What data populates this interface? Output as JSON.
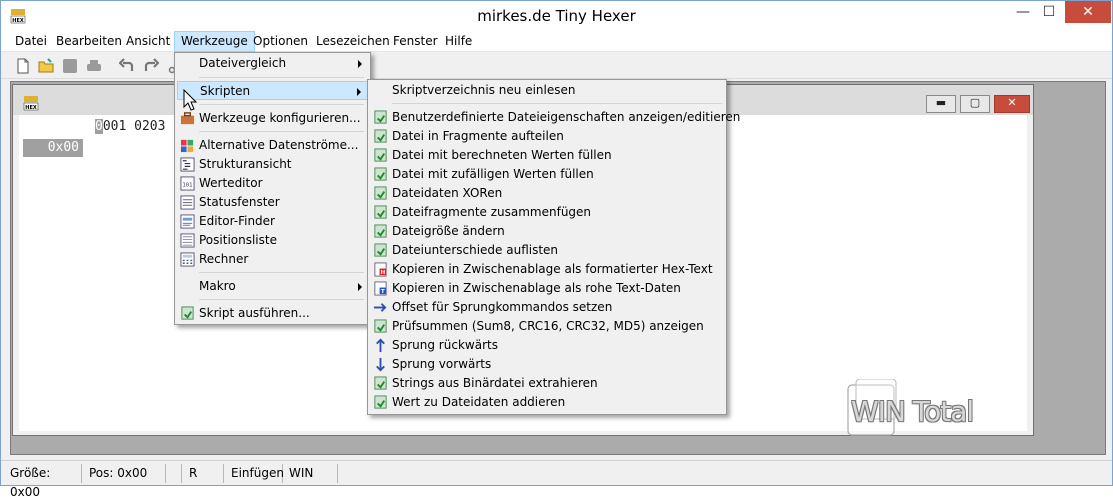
{
  "window": {
    "title": "mirkes.de Tiny Hexer",
    "close_glyph": "✕",
    "min_glyph": "—",
    "max_glyph": "☐"
  },
  "menubar": [
    "Datei",
    "Bearbeiten",
    "Ansicht",
    "Werkzeuge",
    "Optionen",
    "Lesezeichen",
    "Fenster",
    "Hilfe"
  ],
  "child_window": {
    "buttons": {
      "min": "▬",
      "max": "▢",
      "close": "✕"
    }
  },
  "hexview": {
    "header_cursor": "0",
    "header_rest": "001 0203",
    "offset": "0x00"
  },
  "werkzeuge_menu": {
    "items": {
      "dateivergleich": "Dateivergleich",
      "skripten": "Skripten",
      "konfigurieren": "Werkzeuge konfigurieren...",
      "datenstroeme": "Alternative Datenströme...",
      "strukturansicht": "Strukturansicht",
      "werteditor": "Werteditor",
      "statusfenster": "Statusfenster",
      "editor_finder": "Editor-Finder",
      "positionsliste": "Positionsliste",
      "rechner": "Rechner",
      "makro": "Makro",
      "skript_ausfuehren": "Skript ausführen..."
    }
  },
  "skripten_menu": {
    "reload": "Skriptverzeichnis neu einlesen",
    "items": [
      "Benutzerdefinierte Dateieigenschaften anzeigen/editieren",
      "Datei in Fragmente aufteilen",
      "Datei mit berechneten Werten füllen",
      "Datei mit zufälligen Werten füllen",
      "Dateidaten XORen",
      "Dateifragmente zusammenfügen",
      "Dateigröße ändern",
      "Dateiunterschiede auflisten",
      "Kopieren in Zwischenablage als formatierter Hex-Text",
      "Kopieren in Zwischenablage als rohe Text-Daten",
      "Offset für Sprungkommandos setzen",
      "Prüfsummen (Sum8, CRC16, CRC32, MD5) anzeigen",
      "Sprung rückwärts",
      "Sprung vorwärts",
      "Strings aus Binärdatei extrahieren",
      "Wert zu Dateidaten addieren"
    ]
  },
  "statusbar": {
    "size": "Größe: 0x00",
    "pos": "Pos: 0x00",
    "empty": "",
    "mode": "R",
    "insert": "Einfügen",
    "charset": "WIN"
  },
  "watermark": "WIN Total",
  "colors": {
    "highlight": "#cce8ff",
    "highlight_border": "#99d1ff",
    "close_red": "#c74c3c",
    "mdi_bg": "#ababab"
  }
}
